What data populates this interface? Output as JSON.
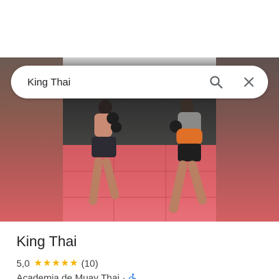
{
  "search": {
    "value": "King Thai",
    "icons": {
      "search": "search-icon",
      "close": "close-icon"
    }
  },
  "photo": {
    "description_icon": "gym-photo"
  },
  "place": {
    "title": "King Thai",
    "rating": "5,0",
    "stars": "★★★★★",
    "review_count": "(10)",
    "category": "Academia de Muay Thai",
    "separator": "·",
    "accessibility_icon": "wheelchair-icon"
  },
  "colors": {
    "star": "#f4b400",
    "text_primary": "#202124",
    "text_secondary": "#3c4043",
    "accessible_blue": "#1a73e8",
    "mat_red": "#e0646c"
  }
}
